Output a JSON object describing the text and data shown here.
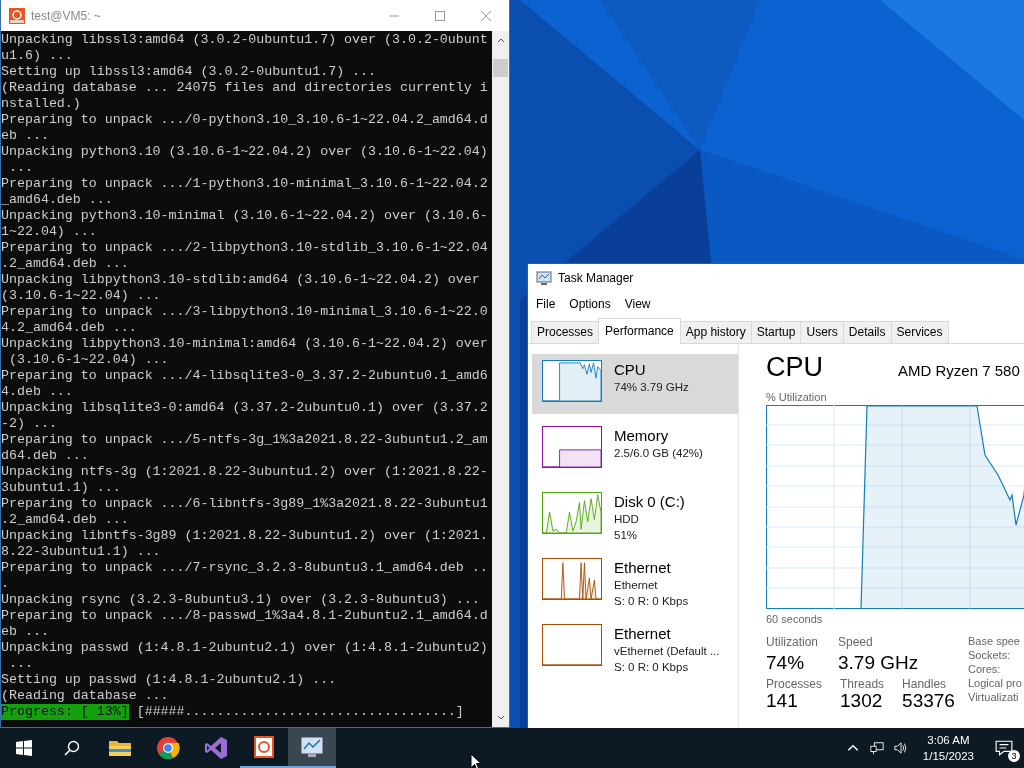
{
  "terminal": {
    "title": "test@VM5: ~",
    "lines": [
      "Unpacking libssl3:amd64 (3.0.2-0ubuntu1.7) over (3.0.2-0ubunt",
      "u1.6) ...",
      "Setting up libssl3:amd64 (3.0.2-0ubuntu1.7) ...",
      "(Reading database ... 24075 files and directories currently i",
      "nstalled.)",
      "Preparing to unpack .../0-python3.10_3.10.6-1~22.04.2_amd64.d",
      "eb ...",
      "Unpacking python3.10 (3.10.6-1~22.04.2) over (3.10.6-1~22.04)",
      " ...",
      "Preparing to unpack .../1-python3.10-minimal_3.10.6-1~22.04.2",
      "_amd64.deb ...",
      "Unpacking python3.10-minimal (3.10.6-1~22.04.2) over (3.10.6-",
      "1~22.04) ...",
      "Preparing to unpack .../2-libpython3.10-stdlib_3.10.6-1~22.04",
      ".2_amd64.deb ...",
      "Unpacking libpython3.10-stdlib:amd64 (3.10.6-1~22.04.2) over",
      "(3.10.6-1~22.04) ...",
      "Preparing to unpack .../3-libpython3.10-minimal_3.10.6-1~22.0",
      "4.2_amd64.deb ...",
      "Unpacking libpython3.10-minimal:amd64 (3.10.6-1~22.04.2) over",
      " (3.10.6-1~22.04) ...",
      "Preparing to unpack .../4-libsqlite3-0_3.37.2-2ubuntu0.1_amd6",
      "4.deb ...",
      "Unpacking libsqlite3-0:amd64 (3.37.2-2ubuntu0.1) over (3.37.2",
      "-2) ...",
      "Preparing to unpack .../5-ntfs-3g_1%3a2021.8.22-3ubuntu1.2_am",
      "d64.deb ...",
      "Unpacking ntfs-3g (1:2021.8.22-3ubuntu1.2) over (1:2021.8.22-",
      "3ubuntu1.1) ...",
      "Preparing to unpack .../6-libntfs-3g89_1%3a2021.8.22-3ubuntu1",
      ".2_amd64.deb ...",
      "Unpacking libntfs-3g89 (1:2021.8.22-3ubuntu1.2) over (1:2021.",
      "8.22-3ubuntu1.1) ...",
      "Preparing to unpack .../7-rsync_3.2.3-8ubuntu3.1_amd64.deb ..",
      ".",
      "Unpacking rsync (3.2.3-8ubuntu3.1) over (3.2.3-8ubuntu3) ...",
      "Preparing to unpack .../8-passwd_1%3a4.8.1-2ubuntu2.1_amd64.d",
      "eb ...",
      "Unpacking passwd (1:4.8.1-2ubuntu2.1) over (1:4.8.1-2ubuntu2)",
      " ...",
      "Setting up passwd (1:4.8.1-2ubuntu2.1) ...",
      "(Reading database ..."
    ],
    "progress": {
      "label": "Progress: [ 13%]",
      "bar": "[#####..................................]"
    }
  },
  "task_manager": {
    "title": "Task Manager",
    "menu": [
      "File",
      "Options",
      "View"
    ],
    "tabs": [
      {
        "label": "Processes",
        "selected": false
      },
      {
        "label": "Performance",
        "selected": true
      },
      {
        "label": "App history",
        "selected": false
      },
      {
        "label": "Startup",
        "selected": false
      },
      {
        "label": "Users",
        "selected": false
      },
      {
        "label": "Details",
        "selected": false
      },
      {
        "label": "Services",
        "selected": false
      }
    ],
    "resources": [
      {
        "name": "CPU",
        "details": [
          "74% 3.79 GHz"
        ],
        "color": "#117dbb",
        "kind": "cpu",
        "selected": true
      },
      {
        "name": "Memory",
        "details": [
          "2.5/6.0 GB (42%)"
        ],
        "color": "#8b12ae",
        "kind": "memory",
        "selected": false
      },
      {
        "name": "Disk 0 (C:)",
        "details": [
          "HDD",
          "51%"
        ],
        "color": "#4da60c",
        "kind": "disk",
        "selected": false
      },
      {
        "name": "Ethernet",
        "details": [
          "Ethernet",
          "S: 0 R: 0 Kbps"
        ],
        "color": "#a74f01",
        "kind": "network",
        "selected": false
      },
      {
        "name": "Ethernet",
        "details": [
          "vEthernet (Default ...",
          "S: 0 R: 0 Kbps"
        ],
        "color": "#a74f01",
        "kind": "flat",
        "selected": false
      }
    ],
    "heading": "CPU",
    "processor": "AMD Ryzen 7 580",
    "graph_label": "% Utilization",
    "time_label": "60 seconds",
    "stats": [
      {
        "label": "Utilization",
        "value": "74%"
      },
      {
        "label": "Speed",
        "value": "3.79 GHz"
      }
    ],
    "counts": [
      {
        "label": "Processes",
        "value": "141"
      },
      {
        "label": "Threads",
        "value": "1302"
      },
      {
        "label": "Handles",
        "value": "53376"
      }
    ],
    "specs": [
      "Base spee",
      "Sockets:",
      "Cores:",
      "Logical pro",
      "Virtualizati"
    ]
  },
  "taskbar": {
    "apps": [
      {
        "kind": "explorer",
        "running": false,
        "active": false
      },
      {
        "kind": "chrome",
        "running": false,
        "active": false
      },
      {
        "kind": "studio",
        "running": false,
        "active": false
      },
      {
        "kind": "ubuntu",
        "running": true,
        "active": false
      },
      {
        "kind": "taskmgr",
        "running": true,
        "active": true
      }
    ],
    "time": "3:06 AM",
    "date": "1/15/2023",
    "notifications": "3"
  }
}
